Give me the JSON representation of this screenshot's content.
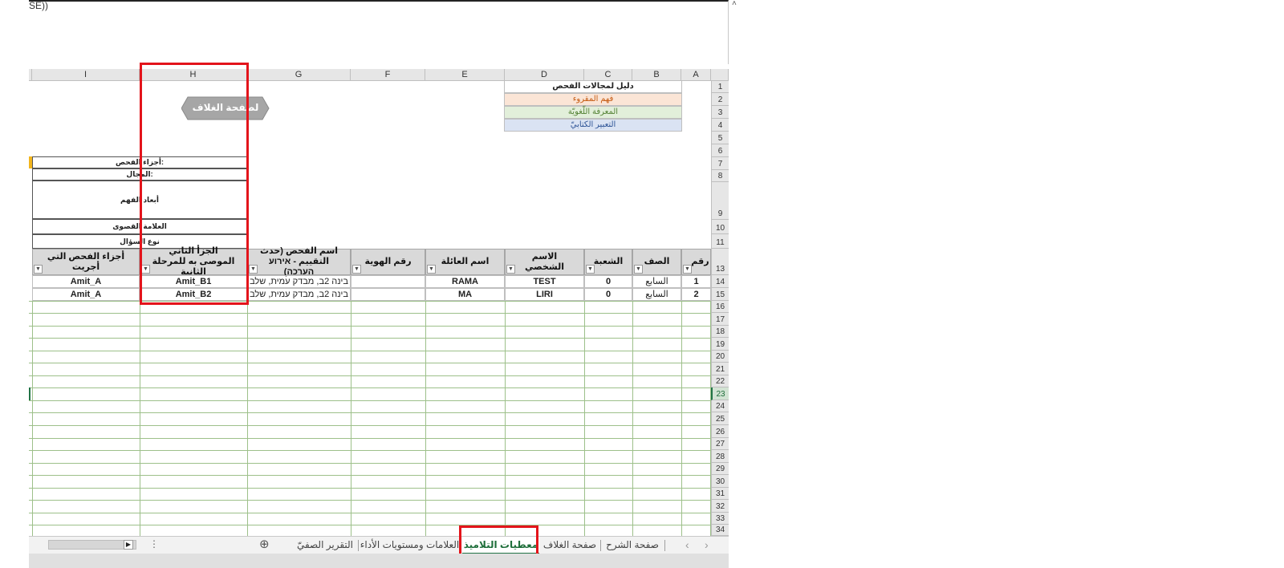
{
  "formula_bar": {
    "text": "SE))",
    "collapse_glyph": "˄"
  },
  "columns": [
    "A",
    "B",
    "C",
    "D",
    "E",
    "F",
    "G",
    "H",
    "I"
  ],
  "rows": [
    "1",
    "2",
    "3",
    "4",
    "5",
    "6",
    "7",
    "8",
    "9",
    "10",
    "11",
    "13",
    "14",
    "15",
    "16",
    "17",
    "18",
    "19",
    "20",
    "21",
    "22",
    "23",
    "24",
    "25",
    "26",
    "27",
    "28",
    "29",
    "30",
    "31",
    "32",
    "33",
    "34"
  ],
  "active_row": "23",
  "legend": {
    "title": "دليل لمجالات الفحص",
    "items": [
      {
        "label": "فهم المقروء",
        "color": "#fbe5d6"
      },
      {
        "label": "المعرفة اللّغويّة",
        "color": "#e2efda"
      },
      {
        "label": "التعبير الكتابيّ",
        "color": "#dae3f3"
      }
    ]
  },
  "cover_button": {
    "label": "لصفحة الغلاف"
  },
  "exam_parts": [
    {
      "label": "أجزاء الفحص:"
    },
    {
      "label": "المجال:"
    },
    {
      "label": "أبعاد الفهم"
    },
    {
      "label": "العلامة القصوى"
    },
    {
      "label": "نوع السؤال"
    }
  ],
  "table": {
    "headers": [
      {
        "col": "A",
        "label": "رقم"
      },
      {
        "col": "B",
        "label": "الصف"
      },
      {
        "col": "C",
        "label": "الشعبة"
      },
      {
        "col": "D",
        "label": "الاسم الشخصي"
      },
      {
        "col": "E",
        "label": "اسم العائلة"
      },
      {
        "col": "F",
        "label": "رقم الهوية"
      },
      {
        "col": "G",
        "label": "اسم الفحص (حدث التقييم - אירוע הערכה)"
      },
      {
        "col": "H",
        "label": "الجزأ الثاني الموصى به للمرحلة الثانية"
      },
      {
        "col": "I",
        "label": "أجزاء الفحص التي أجريت"
      }
    ],
    "rows": [
      {
        "A": "1",
        "B": "السابع",
        "C": "0",
        "D": "TEST",
        "E": "RAMA",
        "F": "",
        "G": "בינה 2ב, מבדק עמית, שלב",
        "H": "Amit_B1",
        "I": "Amit_A"
      },
      {
        "A": "2",
        "B": "السابع",
        "C": "0",
        "D": "LIRI",
        "E": "MA",
        "F": "",
        "G": "בינה 2ב, מבדק עמית, שלב",
        "H": "Amit_B2",
        "I": "Amit_A"
      }
    ]
  },
  "sheet_tabs": {
    "nav_prev": "‹",
    "nav_next": "›",
    "add": "⊕",
    "more": "⋮",
    "items": [
      {
        "label": "صفحة الشرح"
      },
      {
        "label": "صفحة الغلاف"
      },
      {
        "label": "معطيات التلاميذ",
        "active": true
      },
      {
        "label": "العلامات ومستويات الأداء"
      },
      {
        "label": "التقرير الصفيّ"
      }
    ]
  },
  "colors": {
    "grid": "#9dc08a",
    "header_fill": "#d9d9d9",
    "highlight": "#e3141b",
    "active_tab": "#217346"
  }
}
